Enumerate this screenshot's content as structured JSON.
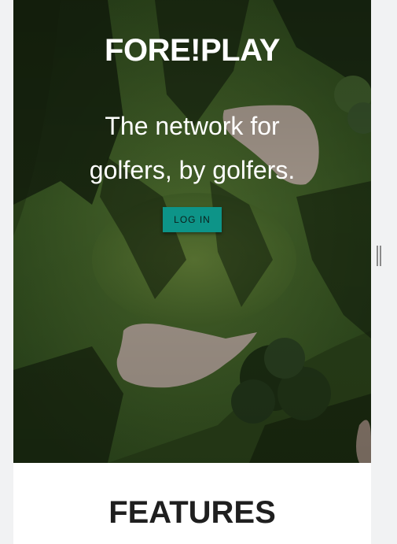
{
  "hero": {
    "brand": "FORE!PLAY",
    "tagline": "The network for golfers, by golfers.",
    "login_label": "LOG IN",
    "background_image": "aerial-golf-course"
  },
  "features": {
    "heading": "FEATURES"
  },
  "colors": {
    "accent": "#0d9488",
    "page_bg": "#f1f2f3",
    "heading_text": "#1f1f1f"
  }
}
